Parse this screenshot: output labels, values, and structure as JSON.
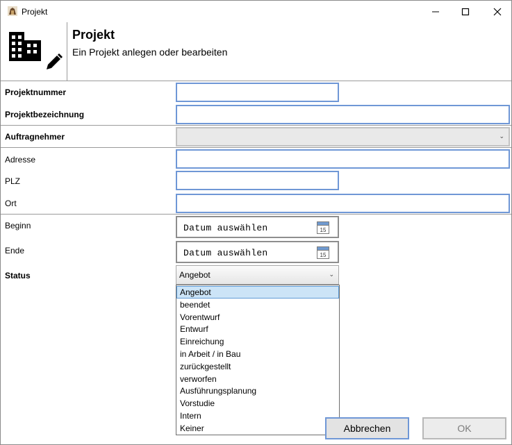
{
  "window": {
    "title": "Projekt"
  },
  "header": {
    "title": "Projekt",
    "subtitle": "Ein Projekt anlegen oder bearbeiten"
  },
  "form": {
    "projektnummer_label": "Projektnummer",
    "projektbezeichnung_label": "Projektbezeichnung",
    "auftragnehmer_label": "Auftragnehmer",
    "adresse_label": "Adresse",
    "plz_label": "PLZ",
    "ort_label": "Ort",
    "beginn_label": "Beginn",
    "ende_label": "Ende",
    "status_label": "Status",
    "beginn_placeholder": "Datum auswählen",
    "ende_placeholder": "Datum auswählen",
    "calendar_day": "15",
    "status_value": "Angebot"
  },
  "status_options": [
    "Angebot",
    "beendet",
    "Vorentwurf",
    "Entwurf",
    "Einreichung",
    "in Arbeit / in Bau",
    "zurückgestellt",
    "verworfen",
    "Ausführungsplanung",
    "Vorstudie",
    "Intern",
    "Keiner"
  ],
  "buttons": {
    "cancel": "Abbrechen",
    "ok": "OK"
  },
  "colors": {
    "input_border": "#6f97d6",
    "selected_option": "#cce4f7"
  }
}
